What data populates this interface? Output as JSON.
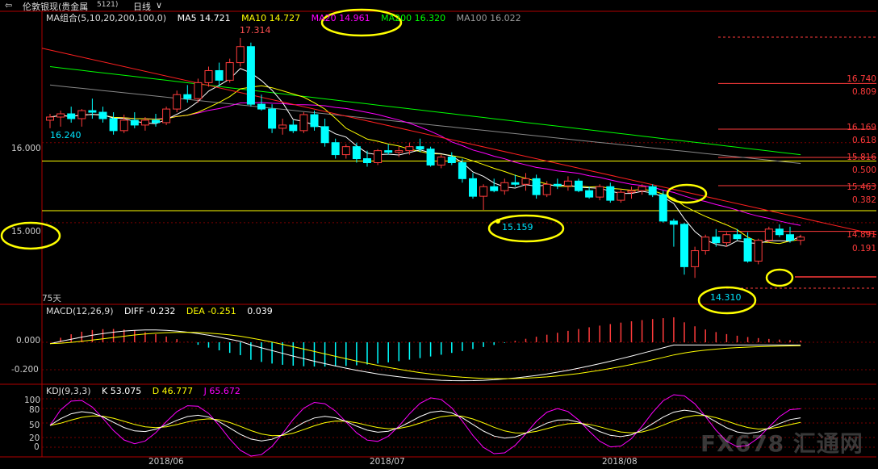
{
  "title_bar": {
    "back_icon": "back-arrow-icon",
    "name": "伦敦银现(贵金属",
    "code": "5121)",
    "period": "日线",
    "dropdown_icon": "chevron-down-icon"
  },
  "legend_ma": {
    "group": "MA组合(5,10,20,200,100,0)",
    "ma5": "MA5 14.721",
    "ma10": "MA10 14.727",
    "ma20": "MA20 14.961",
    "ma200": "MA200 16.320",
    "ma100": "MA100 16.022"
  },
  "legend_macd": {
    "label": "MACD(12,26,9)",
    "diff": "DIFF -0.232",
    "dea": "DEA -0.251",
    "macd": "0.039"
  },
  "legend_kdj": {
    "label": "KDJ(9,3,3)",
    "k": "K 53.075",
    "d": "D 46.777",
    "j": "J 65.672"
  },
  "colors": {
    "up": "#ff3b3b",
    "down": "#00ffff",
    "ma5": "#ffffff",
    "ma10": "#ffff00",
    "ma20": "#ff00ff",
    "ma200": "#00ff00",
    "ma100": "#888888",
    "trend": "#ff2020",
    "support": "#ffff00",
    "fib": "#ff3b3b",
    "highlight": "#ffff00"
  },
  "price_axis": {
    "label_16000": "16.000",
    "label_15000": "15.000"
  },
  "macd_axis": {
    "label_0": "0.000",
    "label_m02": "-0.200"
  },
  "kdj_axis": {
    "label_100": "100",
    "label_80": "80",
    "label_50": "50",
    "label_20": "20",
    "label_0": "0"
  },
  "days_label": "75天",
  "annotations": {
    "high": "17.314",
    "left_low": "16.240",
    "mid_low": "15.159",
    "low": "14.310"
  },
  "fib_labels": [
    {
      "price": "16.740",
      "ratio": "0.809"
    },
    {
      "price": "16.169",
      "ratio": "0.618"
    },
    {
      "price": "15.816",
      "ratio": "0.500"
    },
    {
      "price": "15.463",
      "ratio": "0.382"
    },
    {
      "price": "14.891",
      "ratio": "0.191"
    }
  ],
  "x_labels": [
    "2018/06",
    "2018/07",
    "2018/08"
  ],
  "watermark": "FX678 汇通网",
  "chart_data": {
    "type": "candlestick",
    "title": "伦敦银现(贵金属 5121) 日线",
    "price_ylim": [
      14.0,
      17.5
    ],
    "candles": [
      [
        16.28,
        16.36,
        16.18,
        16.32
      ],
      [
        16.32,
        16.4,
        16.2,
        16.36
      ],
      [
        16.36,
        16.45,
        16.25,
        16.3
      ],
      [
        16.3,
        16.42,
        16.2,
        16.4
      ],
      [
        16.4,
        16.55,
        16.3,
        16.38
      ],
      [
        16.38,
        16.45,
        16.25,
        16.3
      ],
      [
        16.3,
        16.38,
        16.1,
        16.15
      ],
      [
        16.15,
        16.35,
        16.12,
        16.28
      ],
      [
        16.28,
        16.38,
        16.18,
        16.22
      ],
      [
        16.22,
        16.32,
        16.15,
        16.28
      ],
      [
        16.28,
        16.36,
        16.2,
        16.25
      ],
      [
        16.25,
        16.45,
        16.22,
        16.42
      ],
      [
        16.42,
        16.65,
        16.38,
        16.6
      ],
      [
        16.6,
        16.72,
        16.5,
        16.55
      ],
      [
        16.55,
        16.8,
        16.5,
        16.75
      ],
      [
        16.75,
        16.95,
        16.7,
        16.9
      ],
      [
        16.9,
        17.0,
        16.7,
        16.78
      ],
      [
        16.78,
        17.05,
        16.75,
        17.0
      ],
      [
        17.0,
        17.31,
        16.95,
        17.2
      ],
      [
        17.2,
        17.25,
        16.45,
        16.48
      ],
      [
        16.48,
        16.6,
        16.4,
        16.42
      ],
      [
        16.42,
        16.48,
        16.12,
        16.18
      ],
      [
        16.18,
        16.3,
        16.1,
        16.22
      ],
      [
        16.22,
        16.28,
        16.12,
        16.15
      ],
      [
        16.15,
        16.38,
        16.12,
        16.35
      ],
      [
        16.35,
        16.4,
        16.15,
        16.2
      ],
      [
        16.2,
        16.3,
        15.95,
        16.0
      ],
      [
        16.0,
        16.05,
        15.8,
        15.85
      ],
      [
        15.85,
        15.98,
        15.8,
        15.95
      ],
      [
        15.95,
        16.0,
        15.75,
        15.8
      ],
      [
        15.8,
        15.9,
        15.7,
        15.75
      ],
      [
        15.75,
        15.92,
        15.72,
        15.9
      ],
      [
        15.9,
        15.98,
        15.85,
        15.88
      ],
      [
        15.88,
        15.95,
        15.82,
        15.9
      ],
      [
        15.9,
        16.0,
        15.85,
        15.95
      ],
      [
        15.95,
        16.05,
        15.88,
        15.92
      ],
      [
        15.92,
        15.95,
        15.7,
        15.72
      ],
      [
        15.72,
        15.85,
        15.68,
        15.82
      ],
      [
        15.82,
        15.88,
        15.72,
        15.75
      ],
      [
        15.75,
        15.8,
        15.5,
        15.55
      ],
      [
        15.55,
        15.62,
        15.3,
        15.33
      ],
      [
        15.33,
        15.48,
        15.16,
        15.45
      ],
      [
        15.45,
        15.55,
        15.38,
        15.4
      ],
      [
        15.4,
        15.55,
        15.35,
        15.5
      ],
      [
        15.5,
        15.6,
        15.45,
        15.48
      ],
      [
        15.48,
        15.62,
        15.4,
        15.55
      ],
      [
        15.55,
        15.6,
        15.3,
        15.35
      ],
      [
        15.35,
        15.52,
        15.32,
        15.48
      ],
      [
        15.48,
        15.55,
        15.42,
        15.46
      ],
      [
        15.46,
        15.58,
        15.4,
        15.52
      ],
      [
        15.52,
        15.55,
        15.38,
        15.4
      ],
      [
        15.4,
        15.45,
        15.3,
        15.32
      ],
      [
        15.32,
        15.48,
        15.28,
        15.45
      ],
      [
        15.45,
        15.5,
        15.25,
        15.28
      ],
      [
        15.28,
        15.42,
        15.25,
        15.38
      ],
      [
        15.38,
        15.45,
        15.3,
        15.4
      ],
      [
        15.4,
        15.48,
        15.35,
        15.45
      ],
      [
        15.45,
        15.48,
        15.32,
        15.35
      ],
      [
        15.35,
        15.4,
        15.0,
        15.02
      ],
      [
        15.02,
        15.05,
        14.7,
        14.98
      ],
      [
        14.98,
        15.0,
        14.35,
        14.45
      ],
      [
        14.45,
        14.7,
        14.31,
        14.65
      ],
      [
        14.65,
        14.85,
        14.6,
        14.82
      ],
      [
        14.82,
        14.92,
        14.7,
        14.75
      ],
      [
        14.75,
        14.88,
        14.7,
        14.85
      ],
      [
        14.85,
        14.92,
        14.78,
        14.8
      ],
      [
        14.8,
        14.88,
        14.5,
        14.52
      ],
      [
        14.52,
        14.8,
        14.48,
        14.78
      ],
      [
        14.78,
        14.95,
        14.75,
        14.92
      ],
      [
        14.92,
        14.98,
        14.82,
        14.85
      ],
      [
        14.85,
        14.95,
        14.75,
        14.78
      ],
      [
        14.78,
        14.85,
        14.72,
        14.82
      ]
    ],
    "support_levels": [
      15.77,
      15.15
    ],
    "fibonacci": [
      {
        "ratio": 0.809,
        "price": 16.74
      },
      {
        "ratio": 0.618,
        "price": 16.169
      },
      {
        "ratio": 0.5,
        "price": 15.816
      },
      {
        "ratio": 0.382,
        "price": 15.463
      },
      {
        "ratio": 0.191,
        "price": 14.891
      }
    ],
    "macd_ylim": [
      -0.3,
      0.2
    ],
    "kdj_ylim": [
      -10,
      110
    ]
  }
}
